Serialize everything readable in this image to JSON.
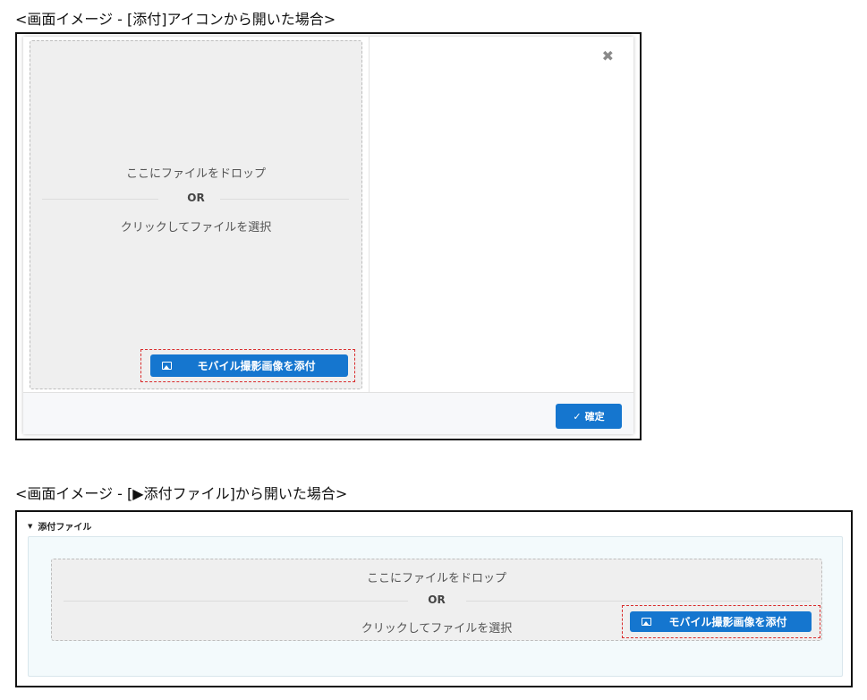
{
  "captions": {
    "first": "<画面イメージ - [添付]アイコンから開いた場合>",
    "second": "<画面イメージ - [▶添付ファイル]から開いた場合>"
  },
  "modal": {
    "close_glyph": "✖",
    "dropzone": {
      "drop_text": "ここにファイルをドロップ",
      "or_text": "OR",
      "click_text": "クリックしてファイルを選択",
      "mobile_button": "モバイル撮影画像を添付"
    },
    "confirm_icon": "✓",
    "confirm_button": "確定"
  },
  "section": {
    "toggle_glyph": "▼",
    "title": "添付ファイル",
    "dropzone": {
      "drop_text": "ここにファイルをドロップ",
      "or_text": "OR",
      "click_text": "クリックしてファイルを選択",
      "mobile_button": "モバイル撮影画像を添付"
    }
  },
  "colors": {
    "accent": "#1576cf",
    "highlight_box": "#d92b2b",
    "dropzone_bg": "#efefef",
    "section_bg": "#f3fafc"
  },
  "icons": {
    "close": "close-icon",
    "image": "image-icon",
    "check": "check-icon",
    "toggle": "caret-down-icon"
  }
}
